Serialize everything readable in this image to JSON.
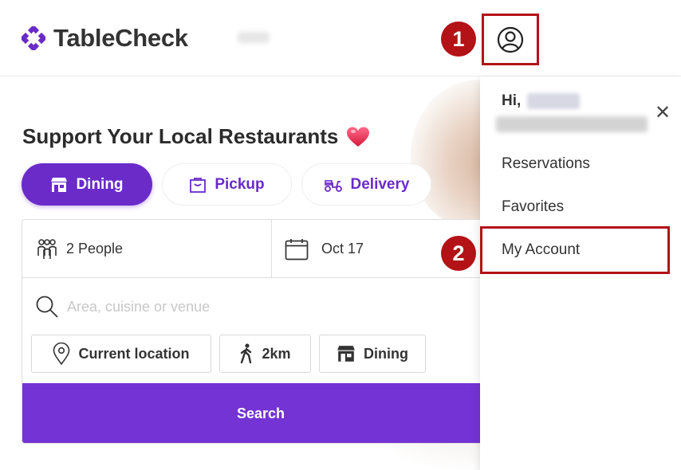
{
  "header": {
    "logo_text": "TableCheck",
    "brand_color": "#6a2bc9"
  },
  "annotations": {
    "step1": "1",
    "step2": "2",
    "highlight_color": "#b31217"
  },
  "hero": {
    "headline": "Support Your Local Restaurants",
    "headline_icon": "heart-icon"
  },
  "tabs": [
    {
      "label": "Dining",
      "icon": "storefront-icon",
      "active": true
    },
    {
      "label": "Pickup",
      "icon": "takeout-bag-icon",
      "active": false
    },
    {
      "label": "Delivery",
      "icon": "scooter-icon",
      "active": false
    }
  ],
  "search_form": {
    "people_value": "2 People",
    "date_value": "Oct 17",
    "search_placeholder": "Area, cuisine or venue",
    "chips": [
      {
        "label": "Current location",
        "icon": "location-pin-icon"
      },
      {
        "label": "2km",
        "icon": "walking-icon"
      },
      {
        "label": "Dining",
        "icon": "storefront-icon"
      }
    ],
    "search_button": "Search",
    "button_color": "#7433d4"
  },
  "user_menu": {
    "greeting": "Hi,",
    "items": [
      "Reservations",
      "Favorites",
      "My Account"
    ],
    "close_icon": "close-icon"
  }
}
